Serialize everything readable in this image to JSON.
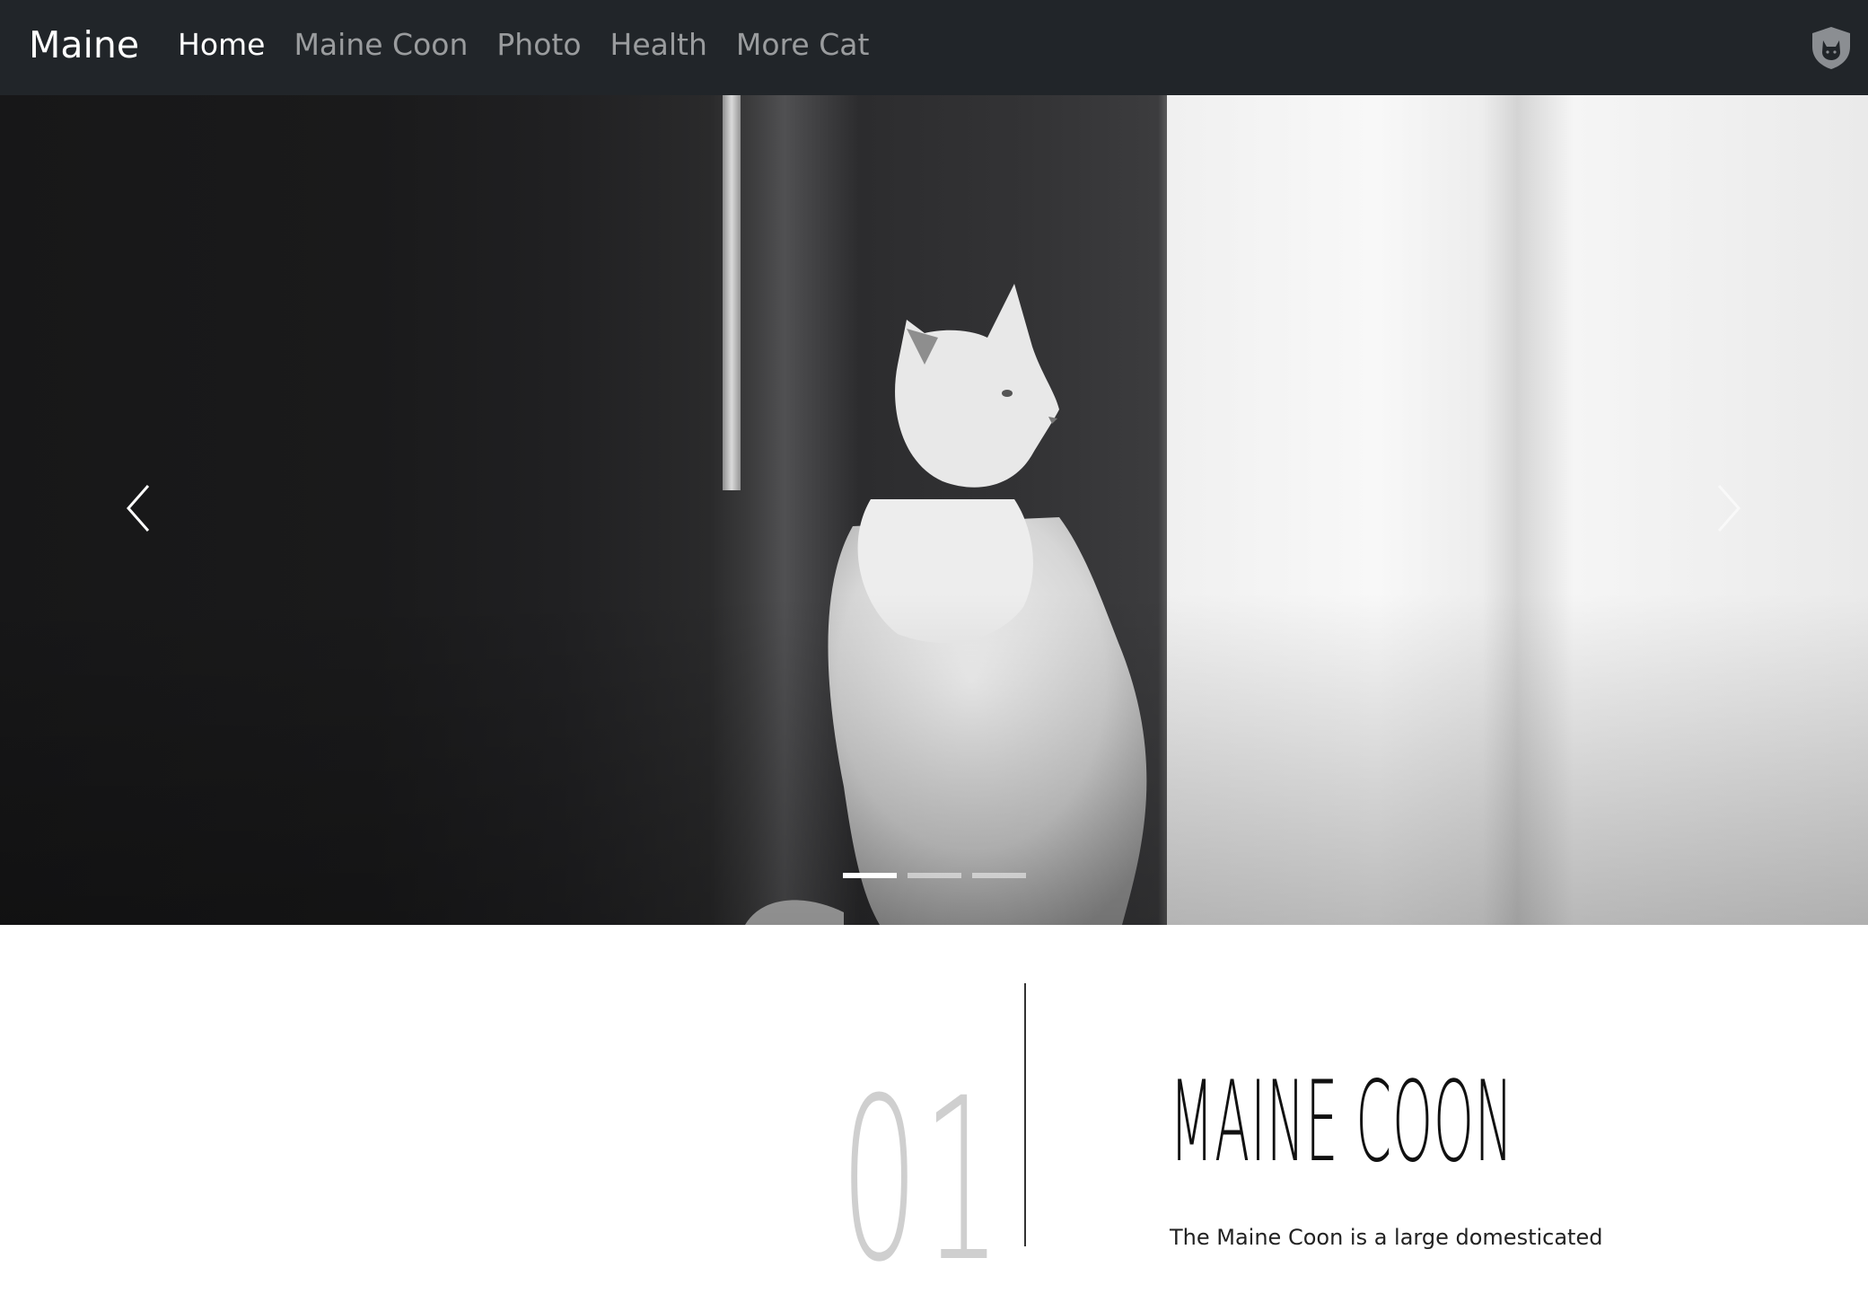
{
  "navbar": {
    "brand": "Maine",
    "links": [
      {
        "label": "Home",
        "active": true
      },
      {
        "label": "Maine Coon",
        "active": false
      },
      {
        "label": "Photo",
        "active": false
      },
      {
        "label": "Health",
        "active": false
      },
      {
        "label": "More Cat",
        "active": false
      }
    ],
    "logo_icon": "cat-shield-icon"
  },
  "carousel": {
    "slide_count": 3,
    "active_index": 0,
    "prev_icon": "chevron-left-icon",
    "next_icon": "chevron-right-icon"
  },
  "feature": {
    "number": "01",
    "title": "MAINE COON",
    "text": "The Maine Coon is a large domesticated"
  },
  "colors": {
    "navbar_bg": "#212529",
    "nav_active": "#ffffff",
    "nav_inactive": "rgba(255,255,255,0.55)",
    "number": "#cfcfcf",
    "title": "#111111"
  }
}
